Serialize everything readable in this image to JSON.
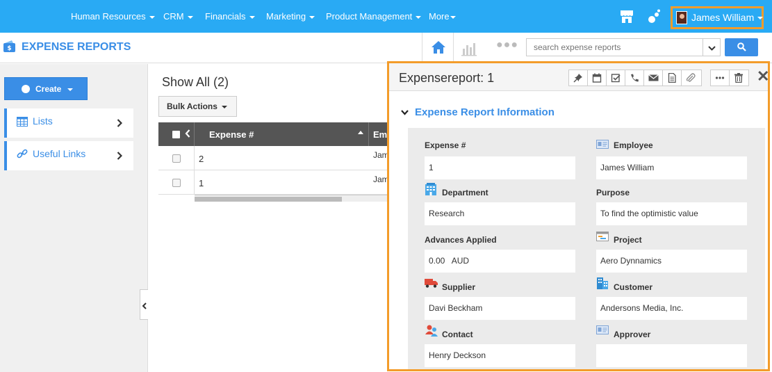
{
  "nav": {
    "items": [
      "Human Resources",
      "CRM",
      "Financials",
      "Marketing",
      "Product Management",
      "More"
    ],
    "user_name": "James William"
  },
  "module": {
    "title": "EXPENSE REPORTS"
  },
  "search": {
    "placeholder": "search expense reports"
  },
  "sidebar": {
    "create_label": "Create",
    "items": [
      {
        "label": "Lists",
        "icon": "table-icon"
      },
      {
        "label": "Useful Links",
        "icon": "link-icon"
      }
    ]
  },
  "list": {
    "heading": "Show All (2)",
    "bulk_label": "Bulk Actions",
    "columns": [
      "Expense #",
      "Em"
    ],
    "rows": [
      {
        "num": "2",
        "employee": "Jam"
      },
      {
        "num": "1",
        "employee": "Jam"
      }
    ]
  },
  "detail": {
    "title": "Expensereport: 1",
    "section_title": "Expense Report Information",
    "fields": [
      {
        "label": "Expense #",
        "value": "1",
        "icon": ""
      },
      {
        "label": "Employee",
        "value": "James William",
        "icon": "id-card-icon"
      },
      {
        "label": "Department",
        "value": "Research",
        "icon": "building-icon"
      },
      {
        "label": "Purpose",
        "value": "To find the optimistic value",
        "icon": ""
      },
      {
        "label": "Advances Applied",
        "value": "0.00   AUD",
        "icon": ""
      },
      {
        "label": "Project",
        "value": "Aero Dynnamics",
        "icon": "project-icon"
      },
      {
        "label": "Supplier",
        "value": "Davi Beckham",
        "icon": "truck-icon"
      },
      {
        "label": "Customer",
        "value": "Andersons Media, Inc.",
        "icon": "office-icon"
      },
      {
        "label": "Contact",
        "value": "Henry Deckson",
        "icon": "contacts-icon"
      },
      {
        "label": "Approver",
        "value": "",
        "icon": "id-card-icon"
      }
    ]
  },
  "colors": {
    "nav_bg": "#29aaf4",
    "accent": "#3a8ee6",
    "highlight": "#f39c2a"
  }
}
